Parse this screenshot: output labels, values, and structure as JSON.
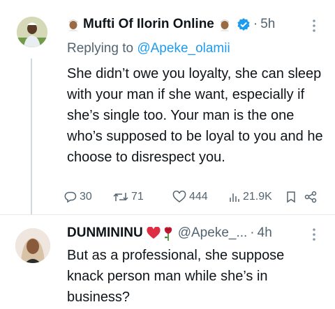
{
  "tweet1": {
    "author": "Mufti Of Ilorin Online",
    "time": "5h",
    "dot": "·",
    "replying_prefix": "Replying to",
    "replying_handle": "@Apeke_olamii",
    "body": "She didn’t owe you loyalty, she can sleep with your man if she want, especially if she’s single too. Your man is the one who’s supposed to be loyal to you and he choose to disrespect you.",
    "stats": {
      "replies": "30",
      "retweets": "71",
      "likes": "444",
      "views": "21.9K"
    },
    "icons": [
      "man-with-cap-emoji",
      "verified-badge-icon",
      "more-icon",
      "reply-icon",
      "retweet-icon",
      "like-icon",
      "views-icon",
      "bookmark-icon",
      "share-icon"
    ]
  },
  "tweet2": {
    "author": "DUNMININU",
    "handle": "@Apeke_...",
    "time": "4h",
    "dot": "·",
    "body": "But as a professional, she suppose knack person man while she’s in business?",
    "icons": [
      "red-heart-emoji",
      "rose-emoji",
      "more-icon"
    ]
  },
  "colors": {
    "accent": "#1d9bf0",
    "muted_text": "#536471",
    "text": "#0f1419",
    "heart": "#e0245e"
  }
}
